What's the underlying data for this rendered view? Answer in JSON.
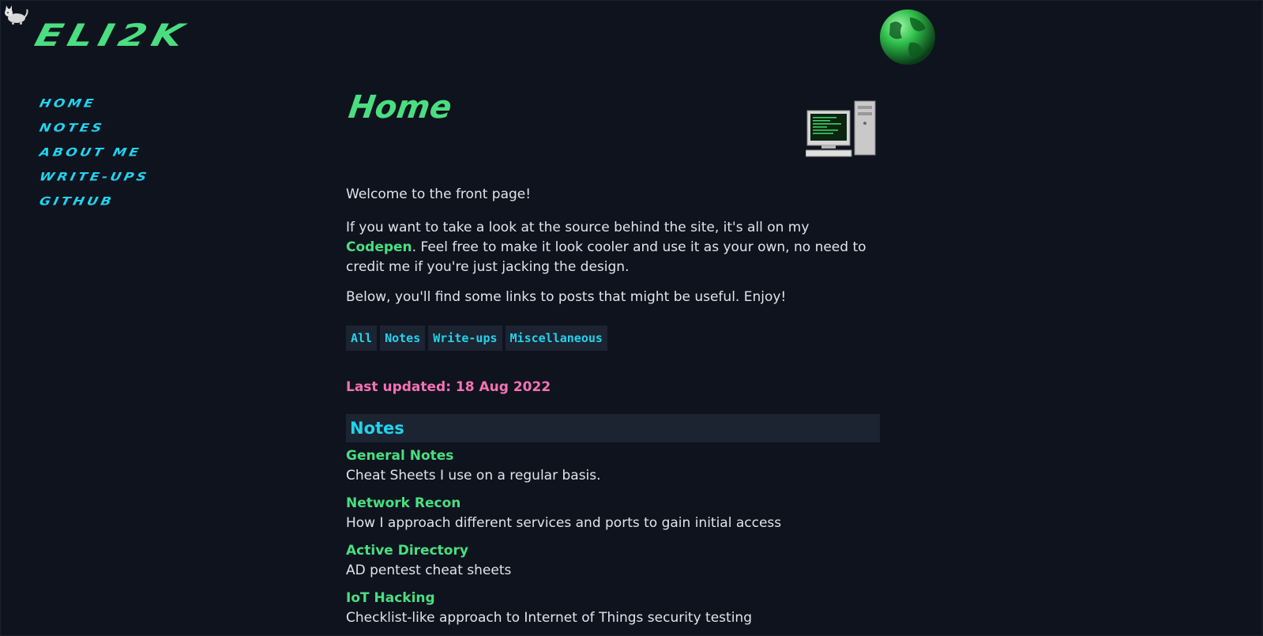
{
  "site": {
    "logo": "ELI2K"
  },
  "nav": {
    "items": [
      {
        "label": "HOME"
      },
      {
        "label": "NOTES"
      },
      {
        "label": "ABOUT ME"
      },
      {
        "label": "WRITE-UPS"
      },
      {
        "label": "GITHUB"
      }
    ]
  },
  "icons": {
    "corner": "cat-icon",
    "globe": "globe-icon",
    "computer": "computer-icon"
  },
  "colors": {
    "background": "#0f131e",
    "accent_green": "#4ade80",
    "accent_cyan": "#22d3ee",
    "accent_pink": "#f472b6",
    "panel": "#1c2331"
  },
  "main": {
    "title": "Home",
    "welcome": "Welcome to the front page!",
    "source_pre": "If you want to take a look at the source behind the site, it's all on my ",
    "source_link": "Codepen",
    "source_post": ". Feel free to make it look cooler and use it as your own, no need to credit me if you're just jacking the design.",
    "below": "Below, you'll find some links to posts that might be useful. Enjoy!",
    "tags": [
      "All",
      "Notes",
      "Write-ups",
      "Miscellaneous"
    ],
    "last_updated": "Last updated: 18 Aug 2022",
    "section_title": "Notes",
    "posts": [
      {
        "title": "General Notes",
        "desc": "Cheat Sheets I use on a regular basis."
      },
      {
        "title": "Network Recon",
        "desc": "How I approach different services and ports to gain initial access"
      },
      {
        "title": "Active Directory",
        "desc": "AD pentest cheat sheets"
      },
      {
        "title": "IoT Hacking",
        "desc": "Checklist-like approach to Internet of Things security testing"
      }
    ]
  }
}
